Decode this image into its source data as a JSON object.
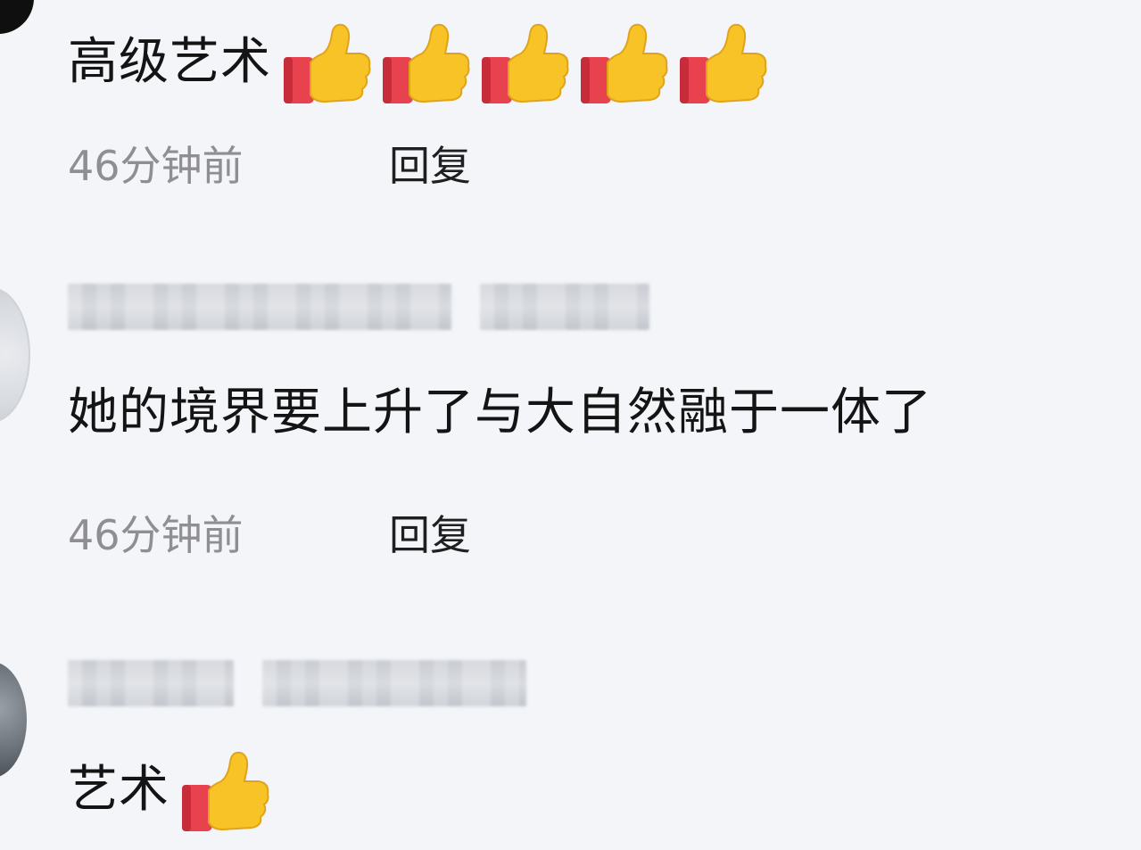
{
  "comments": [
    {
      "text": "高级艺术",
      "emoji_count": 5,
      "time": "46分钟前",
      "reply_label": "回复"
    },
    {
      "text": "她的境界要上升了与大自然融于一体了",
      "time": "46分钟前",
      "reply_label": "回复"
    },
    {
      "text": "艺术",
      "emoji_count": 1
    }
  ],
  "colors": {
    "background": "#f3f5f9",
    "text": "#141414",
    "meta_time": "#8e8e93",
    "thumb_yellow": "#f7c326",
    "thumb_cuff": "#e8424e"
  },
  "icons": {
    "reaction": "thumbs-up-icon"
  }
}
